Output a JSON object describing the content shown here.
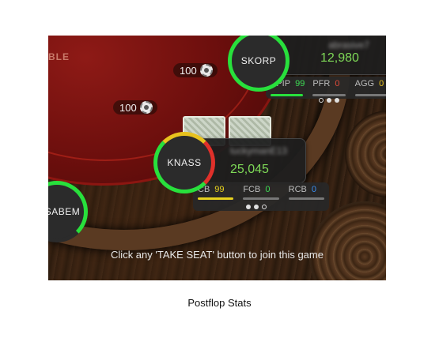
{
  "table": {
    "label": "BLE"
  },
  "bets": [
    {
      "amount": "100"
    },
    {
      "amount": "100"
    }
  ],
  "players": {
    "skorp": {
      "avatar_label": "SKORP",
      "name": "abrasive7",
      "stack": "12,980",
      "ring_color": "#28e03c",
      "stats": [
        {
          "label": "VPIP",
          "value": "99",
          "color": "#3ddc55"
        },
        {
          "label": "PFR",
          "value": "0",
          "color": "#e04a3a"
        },
        {
          "label": "AGG",
          "value": "0",
          "color": "#e8c21e"
        }
      ],
      "pager": [
        "hollow",
        "filled",
        "filled"
      ]
    },
    "knass": {
      "avatar_label": "KNASS",
      "name": "luckymanE13",
      "stack": "25,045",
      "ring_colors": [
        "#28e03c",
        "#e8c21e",
        "#e0302a"
      ],
      "stats": [
        {
          "label": "CB",
          "value": "99",
          "color": "#e8d21e"
        },
        {
          "label": "FCB",
          "value": "0",
          "color": "#3ddc55"
        },
        {
          "label": "RCB",
          "value": "0",
          "color": "#3a8ef0"
        }
      ],
      "pager": [
        "filled",
        "filled",
        "hollow"
      ]
    },
    "sabem": {
      "avatar_label": "SABEM",
      "ring_color": "#28e03c"
    }
  },
  "status_message": "Click any 'TAKE SEAT' button to join this game",
  "caption": "Postflop Stats",
  "icons": {
    "bet_chip": "poker-chip-icon"
  }
}
